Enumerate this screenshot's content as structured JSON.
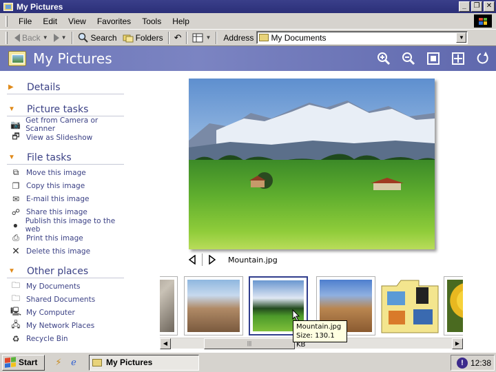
{
  "window": {
    "title": "My Pictures",
    "buttons": {
      "minimize": "_",
      "restore": "❐",
      "close": "✕"
    }
  },
  "menubar": {
    "items": [
      {
        "label": "File"
      },
      {
        "label": "Edit"
      },
      {
        "label": "View"
      },
      {
        "label": "Favorites"
      },
      {
        "label": "Tools"
      },
      {
        "label": "Help"
      }
    ]
  },
  "toolbar": {
    "back_label": "Back",
    "search_label": "Search",
    "folders_label": "Folders",
    "address_label": "Address",
    "address_value": "My Documents"
  },
  "header": {
    "title": "My Pictures"
  },
  "taskpane": {
    "details": {
      "title": "Details"
    },
    "picture_tasks": {
      "title": "Picture tasks",
      "items": [
        {
          "label": "Get from Camera or Scanner",
          "icon": "camera-icon"
        },
        {
          "label": "View as Slideshow",
          "icon": "slideshow-icon"
        }
      ]
    },
    "file_tasks": {
      "title": "File tasks",
      "items": [
        {
          "label": "Move this image",
          "icon": "move-icon"
        },
        {
          "label": "Copy this image",
          "icon": "copy-icon"
        },
        {
          "label": "E-mail this image",
          "icon": "email-icon"
        },
        {
          "label": "Share this image",
          "icon": "share-icon"
        },
        {
          "label": "Publish this image to the web",
          "icon": "globe-icon"
        },
        {
          "label": "Print this image",
          "icon": "printer-icon"
        },
        {
          "label": "Delete this image",
          "icon": "delete-icon"
        }
      ]
    },
    "other_places": {
      "title": "Other places",
      "items": [
        {
          "label": "My Documents",
          "icon": "documents-icon"
        },
        {
          "label": "Shared Documents",
          "icon": "folder-icon"
        },
        {
          "label": "My Computer",
          "icon": "computer-icon"
        },
        {
          "label": "My Network Places",
          "icon": "network-icon"
        },
        {
          "label": "Recycle Bin",
          "icon": "recycle-bin-icon"
        }
      ]
    }
  },
  "preview": {
    "filename": "Mountain.jpg"
  },
  "tooltip": {
    "line1": "Mountain.jpg",
    "line2": "Size:  130.1 KB"
  },
  "taskbar": {
    "start_label": "Start",
    "window_button": "My Pictures",
    "clock": "12:38"
  }
}
